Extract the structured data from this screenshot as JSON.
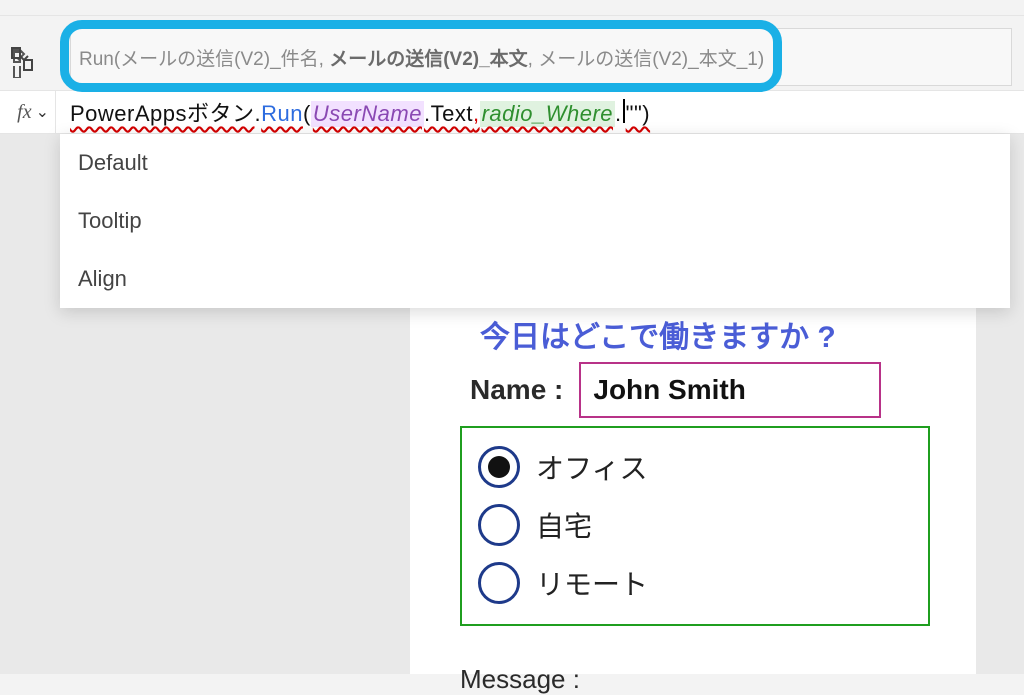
{
  "intellisense": {
    "prefix": "Run(メールの送信(V2)_件名, ",
    "bold": "メールの送信(V2)_本文",
    "suffix": ", メールの送信(V2)_本文_1)"
  },
  "formula": {
    "fx_label": "fx",
    "flow": "PowerAppsボタン",
    "run": "Run",
    "arg1_control": "UserName",
    "arg1_prop": ".Text",
    "arg2_control": "radio_Where",
    "tail": "\"\")"
  },
  "suggestions": {
    "items": [
      {
        "label": "Default"
      },
      {
        "label": "Tooltip"
      },
      {
        "label": "Align"
      }
    ]
  },
  "form": {
    "heading": "今日はどこで働きますか ?",
    "name_label": "Name :",
    "name_value": "John Smith",
    "radio": {
      "selected_index": 0,
      "options": [
        {
          "label": "オフィス"
        },
        {
          "label": "自宅"
        },
        {
          "label": "リモート"
        }
      ]
    },
    "message_label": "Message :"
  }
}
